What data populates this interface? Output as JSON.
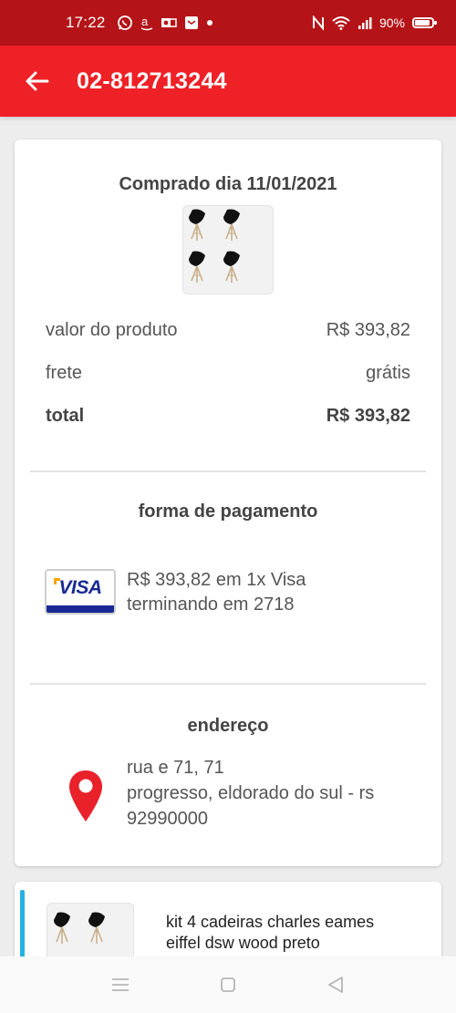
{
  "status_bar": {
    "time": "17:22",
    "battery": "90%",
    "icons": [
      "whatsapp-icon",
      "amazon-icon",
      "outlook-icon",
      "mail-icon",
      "dot-icon",
      "nfc-icon",
      "wifi-icon",
      "signal-icon",
      "battery-icon"
    ]
  },
  "app_bar": {
    "title": "02-812713244",
    "back_icon": "back-arrow-icon",
    "color": "#ee2127"
  },
  "summary": {
    "purchase_date": "Comprado dia 11/01/2021",
    "rows": [
      {
        "label": "valor do produto",
        "value": "R$ 393,82"
      },
      {
        "label": "frete",
        "value": "grátis"
      },
      {
        "label": "total",
        "value": "R$ 393,82"
      }
    ]
  },
  "payment": {
    "title": "forma de pagamento",
    "card_brand": "VISA",
    "line1": "R$ 393,82 em 1x Visa",
    "line2": "terminando em 2718"
  },
  "address": {
    "title": "endereço",
    "line1": "rua e 71, 71",
    "line2": "progresso, eldorado do sul - rs",
    "line3": "92990000",
    "icon": "location-pin-icon",
    "icon_color": "#e8212b"
  },
  "product": {
    "name_line1": "kit 4 cadeiras charles eames",
    "name_line2": "eiffel dsw wood preto",
    "accent_color": "#27b0e2"
  },
  "nav_bar": {
    "icons": [
      "menu-icon",
      "home-icon",
      "back-icon"
    ]
  }
}
